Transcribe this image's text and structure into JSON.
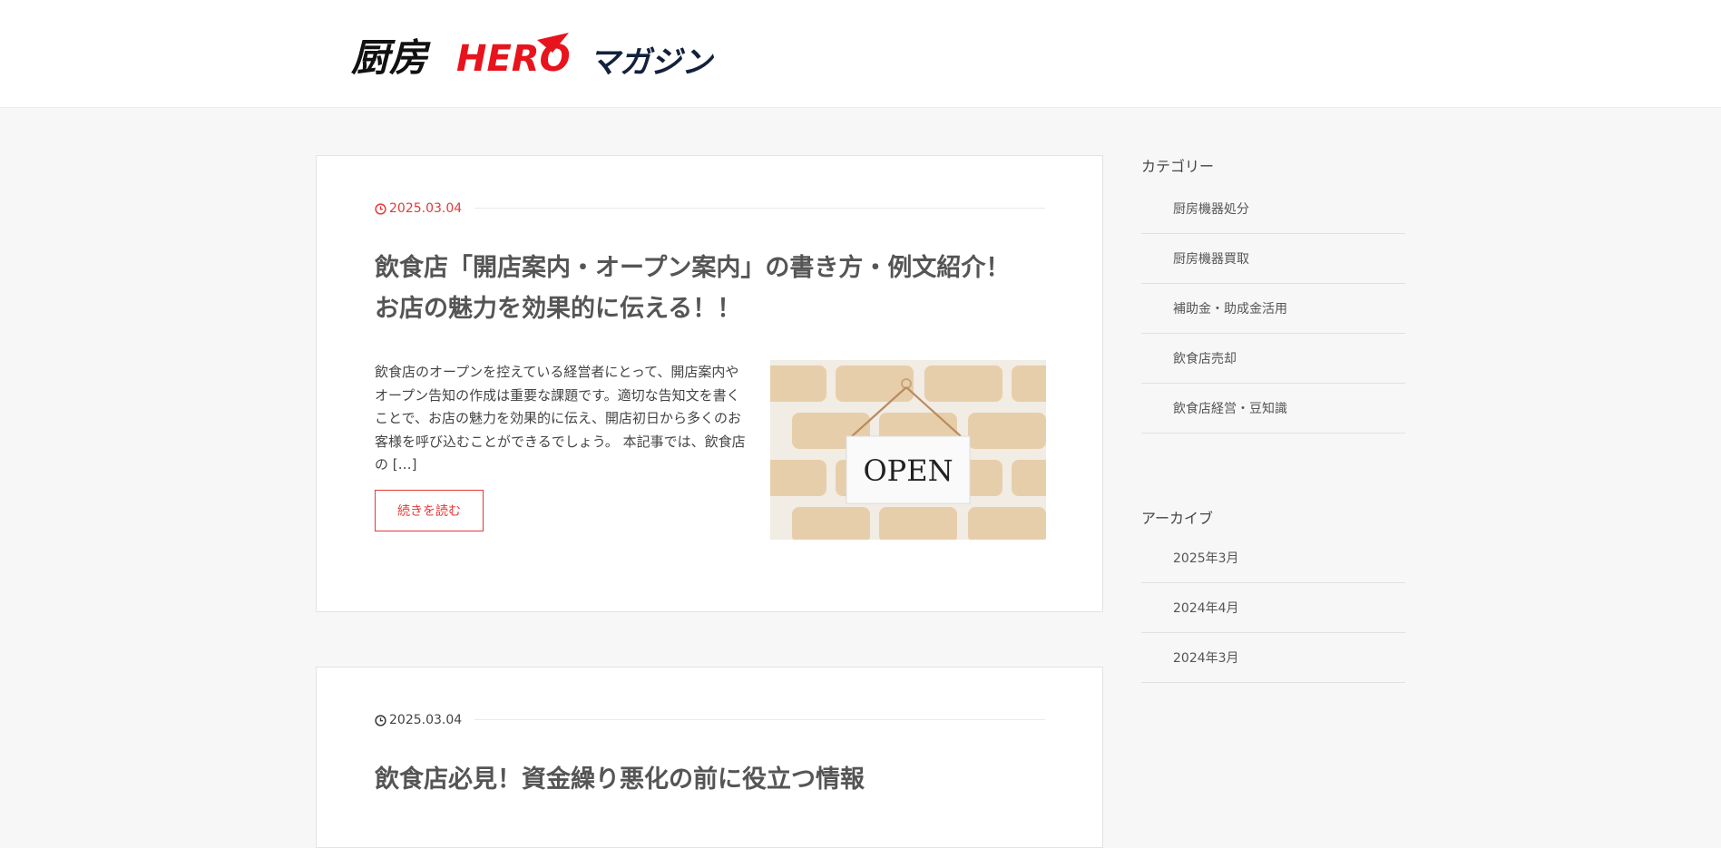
{
  "header": {
    "logo": {
      "part1": "厨房",
      "part2": "HERO",
      "part3": "マガジン"
    }
  },
  "colors": {
    "accent": "#e53935",
    "brand_navy": "#13213c"
  },
  "posts": [
    {
      "date": "2025.03.04",
      "title_line1": "飲食店「開店案内・オープン案内」の書き方・例文紹介！",
      "title_line2": "お店の魅力を効果的に伝える！！",
      "excerpt": "飲食店のオープンを控えている経営者にとって、開店案内やオープン告知の作成は重要な課題です。適切な告知文を書くことで、お店の魅力を効果的に伝え、開店初日から多くのお客様を呼び込むことができるでしょう。 本記事では、飲食店の […]",
      "thumbnail_sign": "OPEN",
      "read_more": "続きを読む"
    },
    {
      "date": "2025.03.04",
      "title_line1": "飲食店必見！資金繰り悪化の前に役立つ情報"
    }
  ],
  "sidebar": {
    "categories": {
      "title": "カテゴリー",
      "items": [
        "厨房機器処分",
        "厨房機器買取",
        "補助金・助成金活用",
        "飲食店売却",
        "飲食店経営・豆知識"
      ]
    },
    "archives": {
      "title": "アーカイブ",
      "items": [
        "2025年3月",
        "2024年4月",
        "2024年3月"
      ]
    }
  }
}
